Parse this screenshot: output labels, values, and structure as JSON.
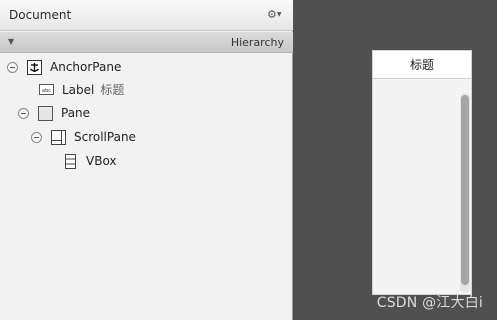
{
  "document_panel": {
    "title": "Document",
    "gear_icon": "gear-icon",
    "hierarchy_label": "Hierarchy"
  },
  "tree": [
    {
      "label": "AnchorPane",
      "secondary": "",
      "icon": "anchor-pane-icon",
      "expanded": true
    },
    {
      "label": "Label",
      "secondary": "标题",
      "icon": "label-icon",
      "expanded": null
    },
    {
      "label": "Pane",
      "secondary": "",
      "icon": "pane-icon",
      "expanded": true
    },
    {
      "label": "ScrollPane",
      "secondary": "",
      "icon": "scroll-pane-icon",
      "expanded": true
    },
    {
      "label": "VBox",
      "secondary": "",
      "icon": "vbox-icon",
      "expanded": null
    }
  ],
  "preview": {
    "title": "标题"
  },
  "watermark": "CSDN @江大白i",
  "colors": {
    "canvas_background": "#505050",
    "panel_background": "#f2f2f2",
    "scrollbar_thumb": "#a6a6a6"
  }
}
